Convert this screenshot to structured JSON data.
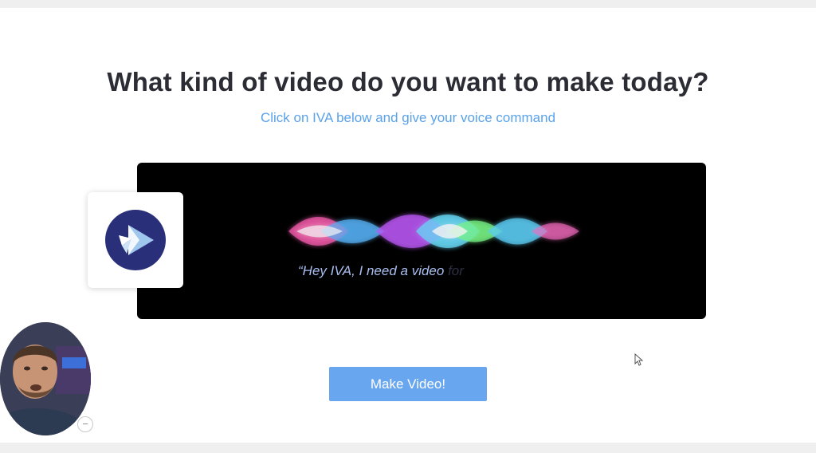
{
  "main": {
    "headline": "What kind of video do you want to make today?",
    "subtitle": "Click on IVA below and give your voice command",
    "prompt_text": "“Hey IVA, I need a video",
    "prompt_fade_text": " for",
    "make_video_label": "Make Video!"
  },
  "icons": {
    "logo": "play-bird-logo-icon",
    "minimize": "minus-icon",
    "cursor": "mouse-pointer-icon"
  },
  "colors": {
    "headline": "#2c2c34",
    "subtitle": "#5aa2ea",
    "button": "#68a6ef",
    "panel": "#000000",
    "logo_circle": "#2a2f7a",
    "prompt": "#a9bff2"
  }
}
